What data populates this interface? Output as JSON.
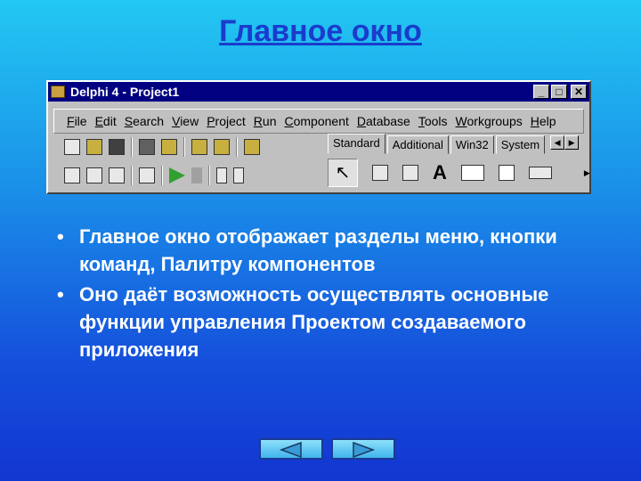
{
  "title": "Главное окно",
  "window": {
    "title": "Delphi 4 - Project1",
    "controls": [
      "_",
      "□",
      "✕"
    ],
    "menu": [
      "File",
      "Edit",
      "Search",
      "View",
      "Project",
      "Run",
      "Component",
      "Database",
      "Tools",
      "Workgroups",
      "Help"
    ],
    "palette_tabs": [
      "Standard",
      "Additional",
      "Win32",
      "System"
    ],
    "active_tab": "Standard"
  },
  "bullets": [
    "Главное окно отображает разделы меню, кнопки команд, Палитру компонентов",
    "Оно даёт возможность осуществлять основные функции управления Проектом создаваемого приложения"
  ],
  "nav": {
    "prev": "arrow-left-icon",
    "next": "arrow-right-icon"
  },
  "colors": {
    "title": "#1a3ccc",
    "titlebar": "#000080"
  }
}
